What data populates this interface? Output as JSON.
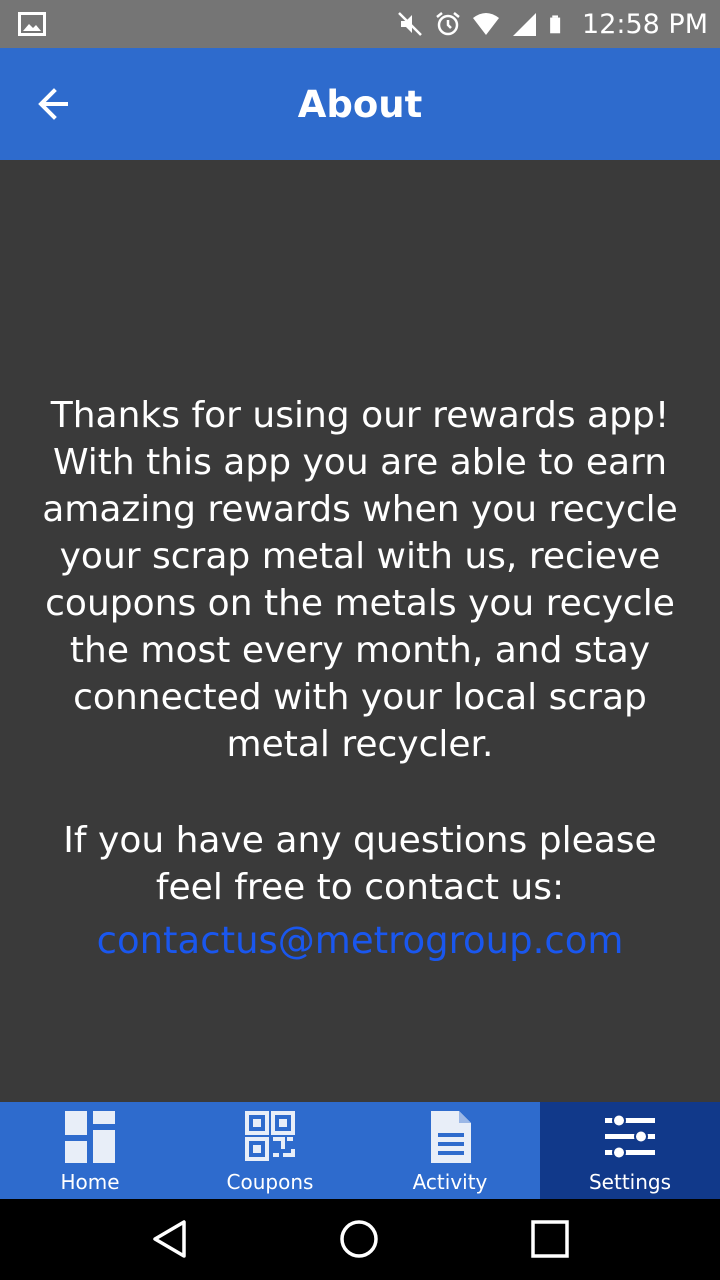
{
  "status_bar": {
    "time": "12:58 PM",
    "icons": [
      "gallery-icon",
      "mute-icon",
      "alarm-icon",
      "wifi-icon",
      "signal-icon",
      "battery-icon"
    ]
  },
  "app_bar": {
    "title": "About",
    "back_icon": "arrow-left-icon",
    "color": "#2e6bcd"
  },
  "content": {
    "about_lines": [
      "Thanks for using our rewards app!",
      "With this app you are able to earn",
      "amazing rewards when you recycle",
      "your scrap metal with us, recieve",
      "coupons on the metals you recycle",
      "the most every month, and stay",
      "connected with your local scrap",
      "metal recycler."
    ],
    "contact_lines": [
      "If you have any questions please",
      "feel free to contact us:"
    ],
    "email": "contactus@metrogroup.com",
    "email_color": "#1a57ee"
  },
  "bottom_nav": {
    "items": [
      {
        "label": "Home",
        "icon": "dashboard-icon",
        "active": false
      },
      {
        "label": "Coupons",
        "icon": "qr-code-icon",
        "active": false
      },
      {
        "label": "Activity",
        "icon": "document-icon",
        "active": false
      },
      {
        "label": "Settings",
        "icon": "sliders-icon",
        "active": true
      }
    ],
    "active_color": "#11398a"
  },
  "system_nav": {
    "icons": [
      "back-triangle-icon",
      "home-circle-icon",
      "recents-square-icon"
    ]
  }
}
